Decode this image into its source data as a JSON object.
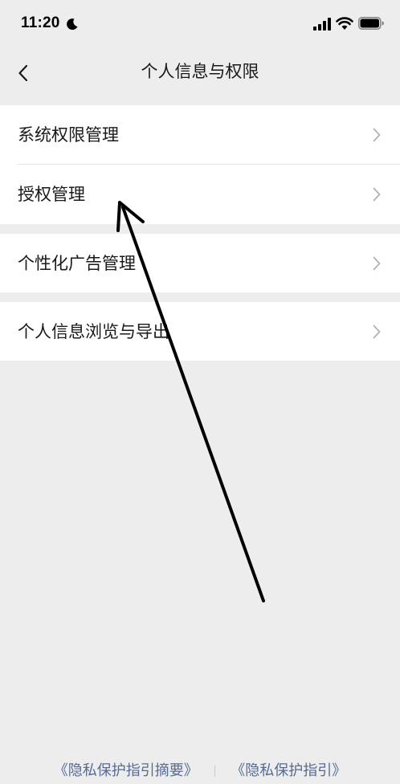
{
  "status_bar": {
    "time": "11:20",
    "icons": [
      "moon-icon",
      "signal-icon",
      "wifi-icon",
      "battery-icon"
    ]
  },
  "nav": {
    "title": "个人信息与权限",
    "back_icon": "chevron-left-icon"
  },
  "groups": [
    {
      "items": [
        {
          "label": "系统权限管理"
        },
        {
          "label": "授权管理"
        }
      ]
    },
    {
      "items": [
        {
          "label": "个性化广告管理"
        }
      ]
    },
    {
      "items": [
        {
          "label": "个人信息浏览与导出"
        }
      ]
    }
  ],
  "footer": {
    "links": [
      "《隐私保护指引摘要》",
      "《隐私保护指引》"
    ]
  },
  "colors": {
    "background": "#ededed",
    "card": "#ffffff",
    "text": "#191919",
    "chevron": "#b2b2b2",
    "link": "#576b95"
  }
}
